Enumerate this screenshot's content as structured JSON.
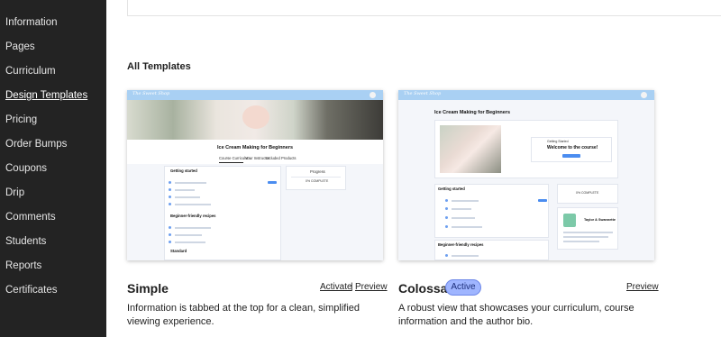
{
  "sidebar": {
    "items": [
      {
        "label": "Information"
      },
      {
        "label": "Pages"
      },
      {
        "label": "Curriculum"
      },
      {
        "label": "Design Templates"
      },
      {
        "label": "Pricing"
      },
      {
        "label": "Order Bumps"
      },
      {
        "label": "Coupons"
      },
      {
        "label": "Drip"
      },
      {
        "label": "Comments"
      },
      {
        "label": "Students"
      },
      {
        "label": "Reports"
      },
      {
        "label": "Certificates"
      }
    ],
    "active": "Design Templates"
  },
  "section": {
    "title": "All Templates"
  },
  "templates": [
    {
      "name": "Simple",
      "activate_label": "Activate",
      "separator": "|",
      "preview_label": "Preview",
      "description": "Information is tabbed at the top for a clean, simplified viewing experience.",
      "thumbnail": {
        "logo": "The Sweet Shop",
        "course_title": "Ice Cream Making for Beginners",
        "tabs": [
          "Course Curriculum",
          "Your Instructor",
          "Included Products"
        ],
        "sections": [
          "Getting started",
          "Beginner-friendly recipes",
          "Standard"
        ],
        "progress_label": "Progress",
        "progress_value": "0% COMPLETE"
      }
    },
    {
      "name": "Colossal",
      "badge": "Active",
      "preview_label": "Preview",
      "description": "A robust view that showcases your curriculum, course information and the author bio.",
      "thumbnail": {
        "logo": "The Sweet Shop",
        "course_title": "Ice Cream Making for Beginners",
        "welcome_small": "Getting Started",
        "welcome": "Welcome to the course!",
        "button": "Start Lesson",
        "sections": [
          "Getting started",
          "Beginner-friendly recipes"
        ],
        "progress_value": "0% COMPLETE",
        "author": "Taylor & Swannette"
      }
    }
  ],
  "colors": {
    "sidebar_bg": "#232323",
    "thumb_header": "#a9d0f3",
    "badge_bg": "#9fb5ff"
  }
}
